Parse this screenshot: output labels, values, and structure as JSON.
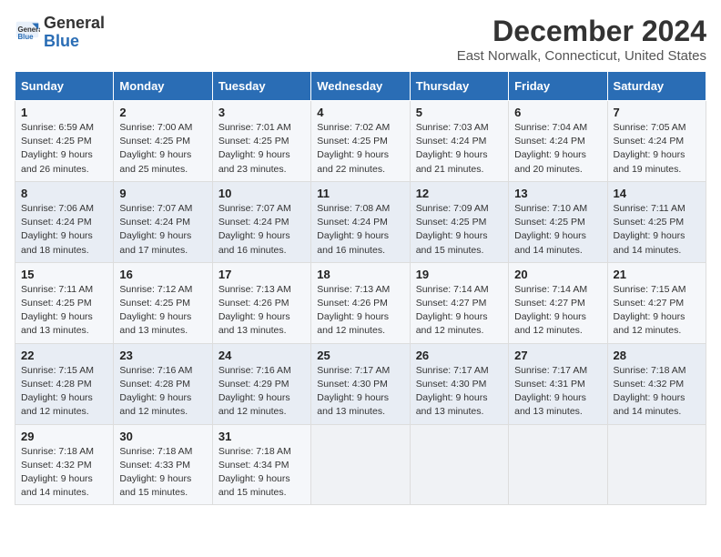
{
  "header": {
    "logo_general": "General",
    "logo_blue": "Blue",
    "month_title": "December 2024",
    "location": "East Norwalk, Connecticut, United States"
  },
  "days_of_week": [
    "Sunday",
    "Monday",
    "Tuesday",
    "Wednesday",
    "Thursday",
    "Friday",
    "Saturday"
  ],
  "weeks": [
    [
      {
        "day": "1",
        "sunrise": "6:59 AM",
        "sunset": "4:25 PM",
        "daylight": "9 hours and 26 minutes."
      },
      {
        "day": "2",
        "sunrise": "7:00 AM",
        "sunset": "4:25 PM",
        "daylight": "9 hours and 25 minutes."
      },
      {
        "day": "3",
        "sunrise": "7:01 AM",
        "sunset": "4:25 PM",
        "daylight": "9 hours and 23 minutes."
      },
      {
        "day": "4",
        "sunrise": "7:02 AM",
        "sunset": "4:25 PM",
        "daylight": "9 hours and 22 minutes."
      },
      {
        "day": "5",
        "sunrise": "7:03 AM",
        "sunset": "4:24 PM",
        "daylight": "9 hours and 21 minutes."
      },
      {
        "day": "6",
        "sunrise": "7:04 AM",
        "sunset": "4:24 PM",
        "daylight": "9 hours and 20 minutes."
      },
      {
        "day": "7",
        "sunrise": "7:05 AM",
        "sunset": "4:24 PM",
        "daylight": "9 hours and 19 minutes."
      }
    ],
    [
      {
        "day": "8",
        "sunrise": "7:06 AM",
        "sunset": "4:24 PM",
        "daylight": "9 hours and 18 minutes."
      },
      {
        "day": "9",
        "sunrise": "7:07 AM",
        "sunset": "4:24 PM",
        "daylight": "9 hours and 17 minutes."
      },
      {
        "day": "10",
        "sunrise": "7:07 AM",
        "sunset": "4:24 PM",
        "daylight": "9 hours and 16 minutes."
      },
      {
        "day": "11",
        "sunrise": "7:08 AM",
        "sunset": "4:24 PM",
        "daylight": "9 hours and 16 minutes."
      },
      {
        "day": "12",
        "sunrise": "7:09 AM",
        "sunset": "4:25 PM",
        "daylight": "9 hours and 15 minutes."
      },
      {
        "day": "13",
        "sunrise": "7:10 AM",
        "sunset": "4:25 PM",
        "daylight": "9 hours and 14 minutes."
      },
      {
        "day": "14",
        "sunrise": "7:11 AM",
        "sunset": "4:25 PM",
        "daylight": "9 hours and 14 minutes."
      }
    ],
    [
      {
        "day": "15",
        "sunrise": "7:11 AM",
        "sunset": "4:25 PM",
        "daylight": "9 hours and 13 minutes."
      },
      {
        "day": "16",
        "sunrise": "7:12 AM",
        "sunset": "4:25 PM",
        "daylight": "9 hours and 13 minutes."
      },
      {
        "day": "17",
        "sunrise": "7:13 AM",
        "sunset": "4:26 PM",
        "daylight": "9 hours and 13 minutes."
      },
      {
        "day": "18",
        "sunrise": "7:13 AM",
        "sunset": "4:26 PM",
        "daylight": "9 hours and 12 minutes."
      },
      {
        "day": "19",
        "sunrise": "7:14 AM",
        "sunset": "4:27 PM",
        "daylight": "9 hours and 12 minutes."
      },
      {
        "day": "20",
        "sunrise": "7:14 AM",
        "sunset": "4:27 PM",
        "daylight": "9 hours and 12 minutes."
      },
      {
        "day": "21",
        "sunrise": "7:15 AM",
        "sunset": "4:27 PM",
        "daylight": "9 hours and 12 minutes."
      }
    ],
    [
      {
        "day": "22",
        "sunrise": "7:15 AM",
        "sunset": "4:28 PM",
        "daylight": "9 hours and 12 minutes."
      },
      {
        "day": "23",
        "sunrise": "7:16 AM",
        "sunset": "4:28 PM",
        "daylight": "9 hours and 12 minutes."
      },
      {
        "day": "24",
        "sunrise": "7:16 AM",
        "sunset": "4:29 PM",
        "daylight": "9 hours and 12 minutes."
      },
      {
        "day": "25",
        "sunrise": "7:17 AM",
        "sunset": "4:30 PM",
        "daylight": "9 hours and 13 minutes."
      },
      {
        "day": "26",
        "sunrise": "7:17 AM",
        "sunset": "4:30 PM",
        "daylight": "9 hours and 13 minutes."
      },
      {
        "day": "27",
        "sunrise": "7:17 AM",
        "sunset": "4:31 PM",
        "daylight": "9 hours and 13 minutes."
      },
      {
        "day": "28",
        "sunrise": "7:18 AM",
        "sunset": "4:32 PM",
        "daylight": "9 hours and 14 minutes."
      }
    ],
    [
      {
        "day": "29",
        "sunrise": "7:18 AM",
        "sunset": "4:32 PM",
        "daylight": "9 hours and 14 minutes."
      },
      {
        "day": "30",
        "sunrise": "7:18 AM",
        "sunset": "4:33 PM",
        "daylight": "9 hours and 15 minutes."
      },
      {
        "day": "31",
        "sunrise": "7:18 AM",
        "sunset": "4:34 PM",
        "daylight": "9 hours and 15 minutes."
      },
      null,
      null,
      null,
      null
    ]
  ]
}
